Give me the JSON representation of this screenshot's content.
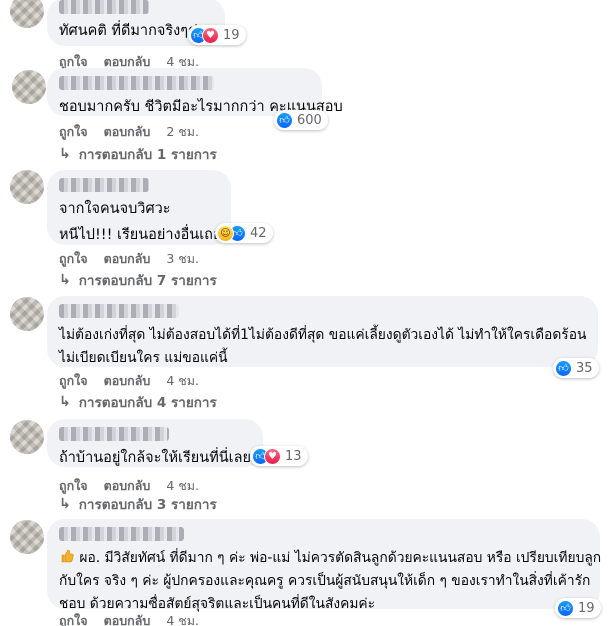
{
  "comments": [
    {
      "text_lines": [
        "ทัศนคติ ที่ดีมากจริงๆค่ะ"
      ],
      "reaction_icons": [
        "like-icon",
        "love-icon"
      ],
      "reaction_count": "19",
      "like_label": "ถูกใจ",
      "reply_label": "ตอบกลับ",
      "time": "4 ชม."
    },
    {
      "text_lines": [
        "ชอบมากครับ ชีวิตมีอะไรมากกว่า คะแนนสอบ"
      ],
      "reaction_icons": [
        "like-icon"
      ],
      "reaction_count": "600",
      "like_label": "ถูกใจ",
      "reply_label": "ตอบกลับ",
      "time": "2 ชม.",
      "replies_text": "การตอบกลับ 1 รายการ"
    },
    {
      "text_lines": [
        "จากใจคนจบวิศวะ",
        "หนีไป!!! เรียนอย่างอื่นเถอะ"
      ],
      "reaction_icons": [
        "haha-icon",
        "like-icon"
      ],
      "reaction_count": "42",
      "like_label": "ถูกใจ",
      "reply_label": "ตอบกลับ",
      "time": "3 ชม.",
      "replies_text": "การตอบกลับ 7 รายการ"
    },
    {
      "text_lines": [
        "ไม่ต้องเก่งที่สุด ไม่ต้องสอบได้ที่1ไม่ต้องดีที่สุด ขอแค่เลี้ยงดูตัวเองได้ ไม่ทำให้ใครเดือดร้อน",
        "ไม่เบียดเบียนใคร แม่ขอแค่นี้"
      ],
      "reaction_icons": [
        "like-icon"
      ],
      "reaction_count": "35",
      "like_label": "ถูกใจ",
      "reply_label": "ตอบกลับ",
      "time": "4 ชม.",
      "replies_text": "การตอบกลับ 4 รายการ"
    },
    {
      "text_lines": [
        "ถ้าบ้านอยู่ใกล้จะให้เรียนที่นี่เลยค่ะ"
      ],
      "reaction_icons": [
        "like-icon",
        "love-icon"
      ],
      "reaction_count": "13",
      "like_label": "ถูกใจ",
      "reply_label": "ตอบกลับ",
      "time": "4 ชม.",
      "replies_text": "การตอบกลับ 3 รายการ"
    },
    {
      "text_lines": [
        "ผอ. มีวิสัยทัศน์ ที่ดีมาก ๆ ค่ะ พ่อ-แม่ ไม่ควรตัดสินลูกด้วยคะแนนสอบ หรือ เปรียบเทียบลูก",
        "กับใคร จริง ๆ ค่ะ ผู้ปกครองและคุณครู ควรเป็นผู้สนับสนุนให้เด็ก ๆ ของเราทำในสิ่งที่เค้ารัก",
        "ชอบ ด้วยความซื่อสัตย์สุจริตและเป็นคนที่ดีในสังคมค่ะ"
      ],
      "leading_emoji": "thumbs-up-emoji",
      "reaction_icons": [
        "like-icon"
      ],
      "reaction_count": "19",
      "like_label": "ถูกใจ",
      "reply_label": "ตอบกลับ",
      "time": "4 ชม."
    }
  ],
  "colors": {
    "bubble": "#f0f2f5",
    "meta_text": "#65676b",
    "like_blue": "#0866ff",
    "love_red": "#e61e4d"
  }
}
